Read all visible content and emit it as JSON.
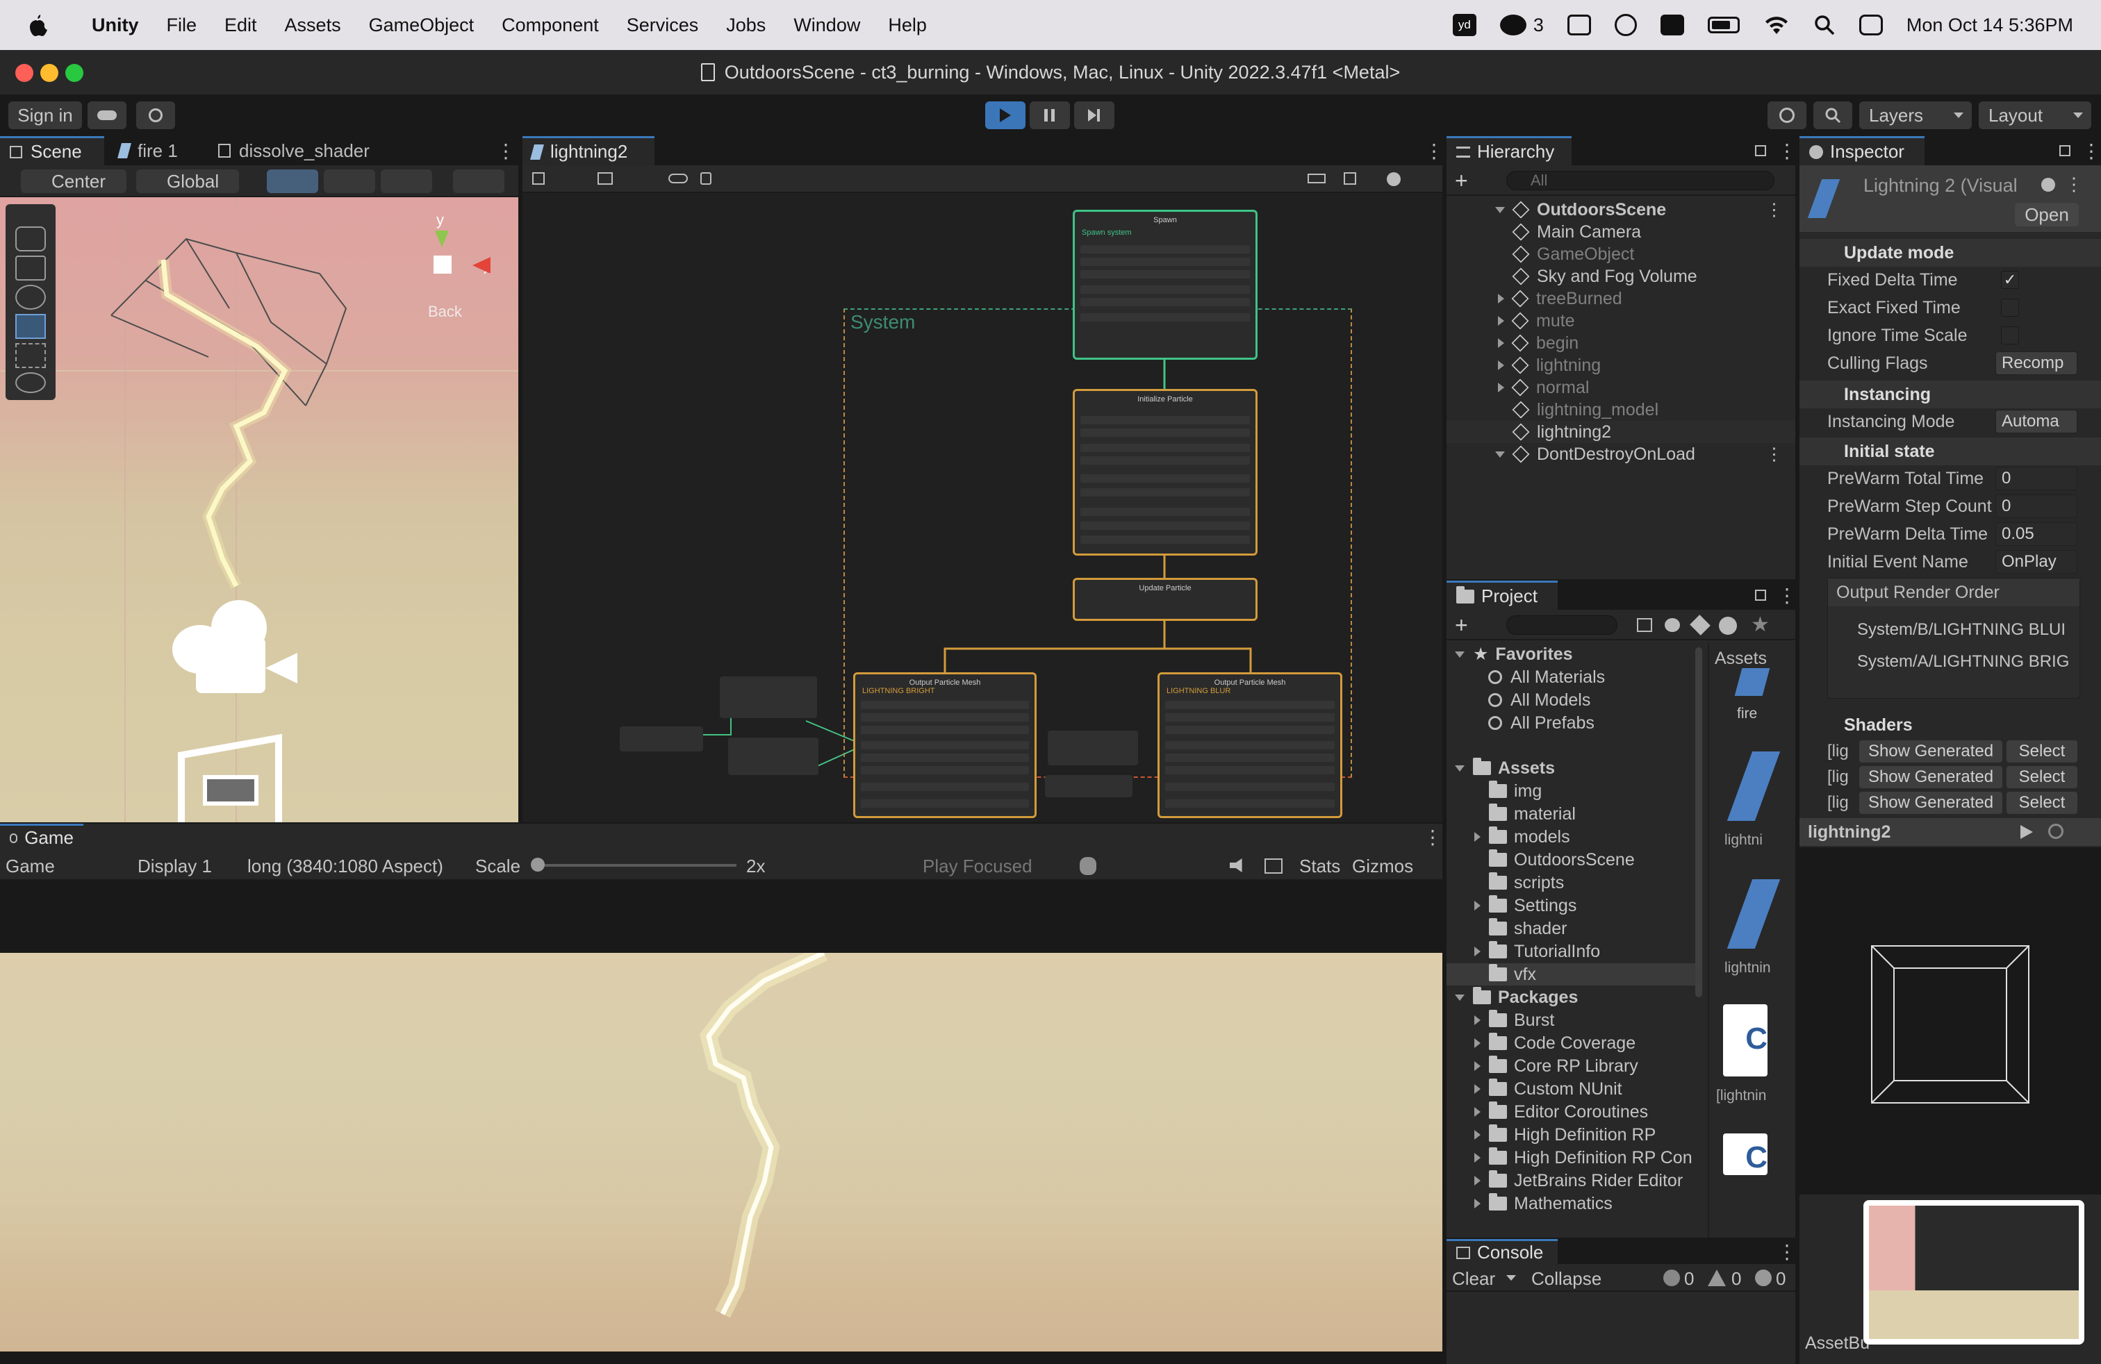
{
  "menubar": {
    "app": "Unity",
    "items": [
      "File",
      "Edit",
      "Assets",
      "GameObject",
      "Component",
      "Services",
      "Jobs",
      "Window",
      "Help"
    ],
    "wechat_count": "3",
    "datetime": "Mon Oct 14  5:36PM"
  },
  "window": {
    "title": "OutdoorsScene - ct3_burning - Windows, Mac, Linux - Unity 2022.3.47f1 <Metal>"
  },
  "toolbar": {
    "sign_in": "Sign in",
    "layers": "Layers",
    "layout": "Layout"
  },
  "scene_panel": {
    "tabs": [
      "Scene",
      "fire 1",
      "dissolve_shader"
    ],
    "pivot": "Center",
    "space": "Global",
    "gizmo_y": "y",
    "gizmo_x": "x",
    "gizmo_back": "Back"
  },
  "vfx_panel": {
    "tab": "lightning2",
    "system_label": "System",
    "nodes": {
      "spawn": {
        "title": "Spawn",
        "sub": "Spawn system"
      },
      "init": {
        "title": "Initialize Particle"
      },
      "update": {
        "title": "Update Particle"
      },
      "out1": {
        "title": "Output Particle Mesh",
        "sub": "LIGHTNING BRIGHT"
      },
      "out2": {
        "title": "Output Particle Mesh",
        "sub": "LIGHTNING BLUR"
      }
    }
  },
  "hierarchy": {
    "tab": "Hierarchy",
    "search_placeholder": "All",
    "items": [
      {
        "label": "OutdoorsScene",
        "dim": false,
        "root": true
      },
      {
        "label": "Main Camera",
        "dim": false
      },
      {
        "label": "GameObject",
        "dim": true
      },
      {
        "label": "Sky and Fog Volume",
        "dim": false
      },
      {
        "label": "treeBurned",
        "dim": true,
        "exp": true
      },
      {
        "label": "mute",
        "dim": true,
        "exp": true
      },
      {
        "label": "begin",
        "dim": true,
        "exp": true
      },
      {
        "label": "lightning",
        "dim": true,
        "exp": true
      },
      {
        "label": "normal",
        "dim": true,
        "exp": true
      },
      {
        "label": "lightning_model",
        "dim": true
      },
      {
        "label": "lightning2",
        "dim": false
      },
      {
        "label": "DontDestroyOnLoad",
        "dim": false,
        "root": true
      }
    ]
  },
  "project": {
    "tab": "Project",
    "breadcrumb": "Assets",
    "favorites_label": "Favorites",
    "favorites": [
      "All Materials",
      "All Models",
      "All Prefabs"
    ],
    "assets_label": "Assets",
    "assets": [
      "img",
      "material",
      "models",
      "OutdoorsScene",
      "scripts",
      "Settings",
      "shader",
      "TutorialInfo",
      "vfx"
    ],
    "packages_label": "Packages",
    "packages": [
      "Burst",
      "Code Coverage",
      "Core RP Library",
      "Custom NUnit",
      "Editor Coroutines",
      "High Definition RP",
      "High Definition RP Con",
      "JetBrains Rider Editor",
      "Mathematics"
    ],
    "grid_items": [
      "fire",
      "lightni",
      "lightnin",
      "[lightnin"
    ]
  },
  "console": {
    "tab": "Console",
    "clear": "Clear",
    "collapse": "Collapse",
    "info_count": "0",
    "warn_count": "0",
    "error_count": "0"
  },
  "inspector": {
    "tab": "Inspector",
    "title": "Lightning 2 (Visual",
    "open": "Open",
    "update_mode": "Update mode",
    "fixed_delta": "Fixed Delta Time",
    "exact_fixed": "Exact Fixed Time",
    "ignore_scale": "Ignore Time Scale",
    "culling_flags": "Culling Flags",
    "culling_value": "Recomp",
    "instancing": "Instancing",
    "instancing_mode": "Instancing Mode",
    "instancing_value": "Automa",
    "initial_state": "Initial state",
    "prewarm_total": "PreWarm Total Time",
    "prewarm_total_val": "0",
    "prewarm_step": "PreWarm Step Count",
    "prewarm_step_val": "0",
    "prewarm_delta": "PreWarm Delta Time",
    "prewarm_delta_val": "0.05",
    "initial_event": "Initial Event Name",
    "initial_event_val": "OnPlay",
    "output_order": "Output Render Order",
    "order_items": [
      "System/B/LIGHTNING BLUI",
      "System/A/LIGHTNING BRIG"
    ],
    "shaders": "Shaders",
    "shader_rows": [
      {
        "prefix": "[lig",
        "show": "Show Generated",
        "select": "Select"
      },
      {
        "prefix": "[lig",
        "show": "Show Generated",
        "select": "Select"
      },
      {
        "prefix": "[lig",
        "show": "Show Generated",
        "select": "Select"
      }
    ],
    "preview_label": "lightning2",
    "assetbundle": "AssetBu"
  },
  "game_panel": {
    "tab": "Game",
    "mode": "Game",
    "display": "Display 1",
    "aspect": "long (3840:1080 Aspect)",
    "scale": "Scale",
    "scale_value": "2x",
    "play_focused": "Play Focused",
    "stats": "Stats",
    "gizmos": "Gizmos"
  }
}
